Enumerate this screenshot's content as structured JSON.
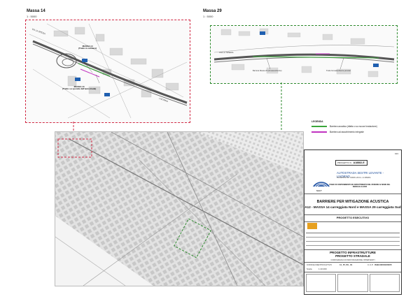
{
  "insets": {
    "left": {
      "title": "Massa 14",
      "scale": "1 : 5000"
    },
    "right": {
      "title": "Massa 29",
      "scale": "1 : 5000"
    }
  },
  "left_notes": {
    "massa14_upper": "MASSA 14\n(Tratto in cantiere)",
    "massa14_lower": "MASSA 14\n(Tratto su sponda dell'autostrada)",
    "road_label": "VIA LA SPEZIA",
    "city_label": "LIVORNO"
  },
  "right_notes": {
    "road_label": "VIA LA SPEZIA",
    "note_a": "Barriera Massa 29 (fonoassorbente)",
    "note_b": "Tratto fonoassorbente previsto"
  },
  "legend": {
    "title": "LEGENDA",
    "items": [
      {
        "label": "Barriera acustica (rifatta o su nuova fondazione)",
        "color": "#3aa53a"
      },
      {
        "label": "Barriera ad assorbimento integrale",
        "color": "#c032c0"
      }
    ]
  },
  "title_block": {
    "sheet_code_label": "PROGETTO N.",
    "sheet_code": "A18882-E",
    "sheet_number": "023",
    "company_name": "AUTOSTRADA SESTRI LEVANTE - LIVORNO",
    "company_sub": "VIA DEI PINI 19 - 19038 LUCCA - LA SPEZIA",
    "logo_text": "SALT",
    "plan_text": "PIANO DI CONTENIMENTO ED ABBATTIMENTO DEL RUMORE AI SENSI DEL DMAM 29-11-2000",
    "main_title": "BARRIERE PER MITIGAZIONE ACUSTICA",
    "sub_title": "A12 - MASSA 14 carreggiata Nord e MASSA 29 carreggiata Sud",
    "phase": "PROGETTO ESECUTIVO",
    "project_line1": "PROGETTO INFRASTRUTTURE",
    "project_line2": "PROGETTO STRADALE",
    "project_line3": "COROGRAFIA DI INDIVIDUAZIONE INTERVENTI",
    "code_label": "CODICE IDENTIFICATIVO",
    "code_value": "11_PI_PA_01",
    "cup_label": "C.U.P.",
    "cup_value": "I61B13000230005",
    "scale_label": "Scala",
    "scale_value": "1:10.000"
  },
  "colors": {
    "inset_red": "#d22a45",
    "inset_green": "#2c8a2c",
    "barrier_green": "#3aa53a",
    "barrier_magenta": "#c032c0",
    "note_blue": "#1f5fb0"
  }
}
